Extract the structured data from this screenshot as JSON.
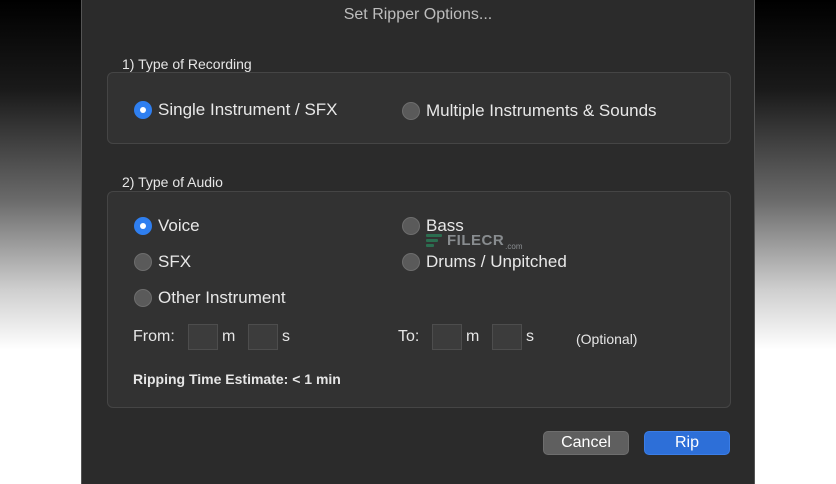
{
  "dialog": {
    "title": "Set Ripper Options...",
    "recording_section": {
      "label": "1) Type of Recording",
      "options": [
        {
          "label": "Single Instrument / SFX",
          "checked": true
        },
        {
          "label": "Multiple Instruments & Sounds",
          "checked": false
        }
      ]
    },
    "audio_section": {
      "label": "2) Type of Audio",
      "options": [
        {
          "label": "Voice",
          "checked": true
        },
        {
          "label": "Bass",
          "checked": false
        },
        {
          "label": "SFX",
          "checked": false
        },
        {
          "label": "Drums / Unpitched",
          "checked": false
        },
        {
          "label": "Other Instrument",
          "checked": false
        }
      ],
      "from_label": "From:",
      "to_label": "To:",
      "minutes_unit": "m",
      "seconds_unit": "s",
      "from_minutes": "",
      "from_seconds": "",
      "to_minutes": "",
      "to_seconds": "",
      "optional_label": "(Optional)",
      "estimate_text": "Ripping Time Estimate: < 1 min"
    },
    "buttons": {
      "cancel": "Cancel",
      "rip": "Rip"
    }
  },
  "watermark": {
    "text": "FILECR",
    "suffix": ".com"
  },
  "colors": {
    "accent": "#2f7ff0",
    "dialog_bg": "#2b2b2b",
    "group_bg": "#323232"
  }
}
